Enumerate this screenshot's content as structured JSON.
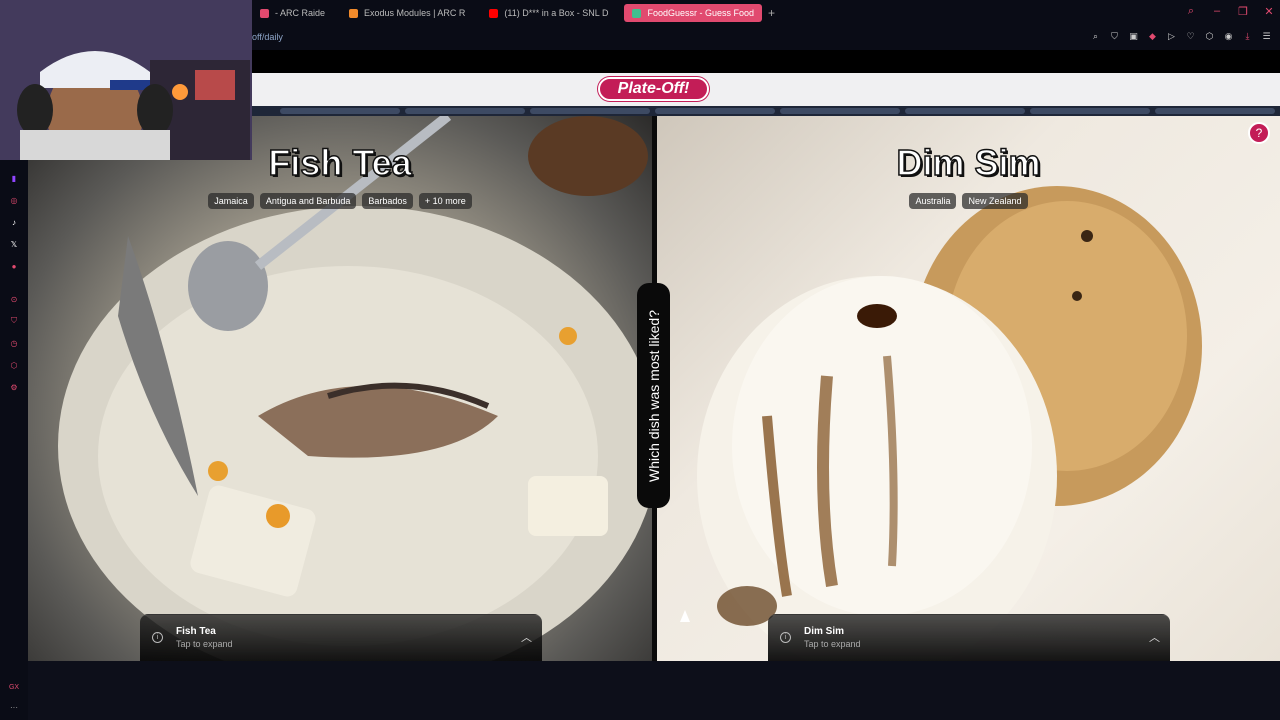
{
  "browser": {
    "tabs": [
      {
        "label": "- ARC Raide",
        "color": "#e14a6f",
        "active": false
      },
      {
        "label": "Exodus Modules | ARC R",
        "color": "#f28b2b",
        "active": false
      },
      {
        "label": "(11) D*** in a Box - SNL D",
        "color": "#ff0000",
        "active": false
      },
      {
        "label": "FoodGuessr - Guess Food",
        "color": "#3fbf8f",
        "active": true
      }
    ],
    "new_tab": "+",
    "url": "off/daily"
  },
  "sidebar": {
    "bottom_label": "GX",
    "more_label": "···"
  },
  "game": {
    "logo": "Plate-Off!",
    "question": "Which dish was most liked?",
    "help_icon": "?",
    "left": {
      "title": "Fish Tea",
      "tags": [
        "Jamaica",
        "Antigua and Barbuda",
        "Barbados",
        "+ 10 more"
      ],
      "banner_name": "Fish Tea",
      "banner_sub": "Tap to expand"
    },
    "right": {
      "title": "Dim Sim",
      "tags": [
        "Australia",
        "New Zealand"
      ],
      "banner_name": "Dim Sim",
      "banner_sub": "Tap to expand"
    }
  },
  "colors": {
    "accent": "#c31d57",
    "opera_red": "#e14a6f"
  }
}
